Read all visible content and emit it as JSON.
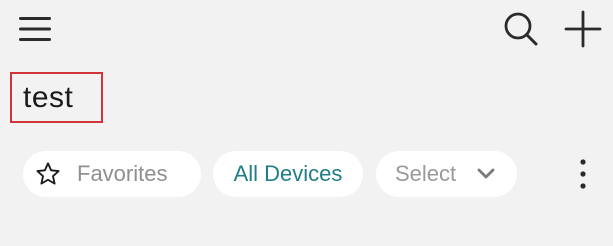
{
  "header": {
    "menu_icon": "hamburger-menu-icon",
    "search_icon": "search-icon",
    "add_icon": "plus-icon"
  },
  "page": {
    "title": "test"
  },
  "filters": {
    "favorites_label": "Favorites",
    "favorites_icon": "star-outline-icon",
    "all_devices_label": "All Devices",
    "select_label": "Select",
    "select_icon": "chevron-down-icon",
    "more_icon": "more-vertical-icon"
  },
  "colors": {
    "background": "#f2f2f2",
    "chip_background": "#ffffff",
    "accent": "#1f7e86",
    "highlight_border": "#d13438",
    "muted_text": "#8f8f8f",
    "title_text": "#1a1a1a"
  }
}
